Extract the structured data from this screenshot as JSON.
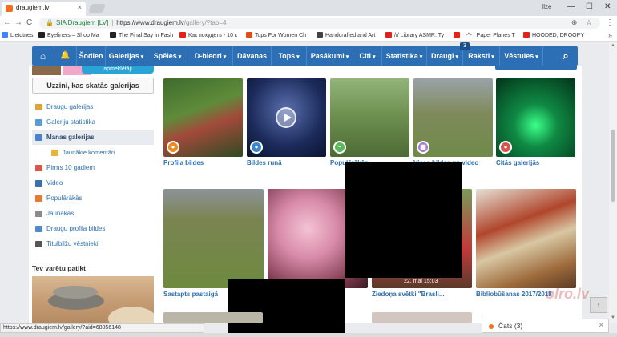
{
  "browser": {
    "tab_title": "draugiem.lv",
    "tab_close": "×",
    "user_label": "Ilze",
    "win_min": "—",
    "win_max": "☐",
    "win_close": "✕",
    "back": "←",
    "forward": "→",
    "reload": "C",
    "site_owner": "SIA Draugiem [LV]",
    "url_separator": "|",
    "url_host": "https://www.draugiem.lv",
    "url_path": "/gallery/?tab=4",
    "url_actions": "⊕ ☆",
    "menu": "⋮",
    "status_url": "https://www.draugiem.lv/gallery/?aid=68056148"
  },
  "bookmarks": [
    {
      "label": "Lietotnes",
      "color": "#4285f4"
    },
    {
      "label": "Eyeliners – Shop Ma",
      "color": "#222222"
    },
    {
      "label": "The Final Say in Fash",
      "color": "#222222"
    },
    {
      "label": "Как похудеть - 10 к",
      "color": "#e62117"
    },
    {
      "label": "Tops For Women Ch",
      "color": "#e64a19"
    },
    {
      "label": "Handcrafted and Art",
      "color": "#444444"
    },
    {
      "label": "/// Library ASMR: Ty",
      "color": "#e62117"
    },
    {
      "label": "_-^-_ Paper Planes T",
      "color": "#e62117"
    },
    {
      "label": "HOODED, DROOPY",
      "color": "#e62117"
    }
  ],
  "bookmarks_more": "»",
  "nav": {
    "home_icon": "⌂",
    "bell_icon": "🔔",
    "search_icon": "⌕",
    "caret": "▾",
    "friends_badge": "3",
    "items": [
      {
        "label": "Šodien",
        "has_caret": false
      },
      {
        "label": "Galerijas",
        "has_caret": true
      },
      {
        "label": "Spēles",
        "has_caret": true
      },
      {
        "label": "D-biedri",
        "has_caret": true
      },
      {
        "label": "Dāvanas",
        "has_caret": false
      },
      {
        "label": "Tops",
        "has_caret": true
      },
      {
        "label": "Pasākumi",
        "has_caret": true
      },
      {
        "label": "Citi",
        "has_caret": true
      },
      {
        "label": "Statistika",
        "has_caret": true
      },
      {
        "label": "Draugi",
        "has_caret": true
      },
      {
        "label": "Raksti",
        "has_caret": true
      },
      {
        "label": "Vēstules",
        "has_caret": true
      }
    ]
  },
  "top_banner": "apmeklētāji",
  "sidebar": {
    "watch_button": "Uzzini, kas skatās galerijas",
    "items": [
      {
        "label": "Draugu galerijas",
        "color": "#d9a441",
        "active": false,
        "sub": false
      },
      {
        "label": "Galeriju statistika",
        "color": "#5b9bd5",
        "active": false,
        "sub": false
      },
      {
        "label": "Manas galerijas",
        "color": "#4b83c4",
        "active": true,
        "sub": false
      },
      {
        "label": "Jaunākie komentāri",
        "color": "#e8b339",
        "active": false,
        "sub": true
      },
      {
        "label": "Pirms 10 gadiem",
        "color": "#d8564c",
        "active": false,
        "sub": false
      },
      {
        "label": "Video",
        "color": "#3a6fb0",
        "active": false,
        "sub": false
      },
      {
        "label": "Populārākās",
        "color": "#e07b39",
        "active": false,
        "sub": false
      },
      {
        "label": "Jaunākās",
        "color": "#8a8a8a",
        "active": false,
        "sub": false
      },
      {
        "label": "Draugu profila bildes",
        "color": "#4f8bc9",
        "active": false,
        "sub": false
      },
      {
        "label": "Titulbilžu vēstnieki",
        "color": "#555555",
        "active": false,
        "sub": false
      }
    ],
    "you_may_like": "Tev varētu patikt"
  },
  "gallery_row1": [
    {
      "label": "Profila bildes",
      "icon_color": "#e98a1f",
      "icon": "●"
    },
    {
      "label": "Bildes runā",
      "icon_color": "#3a86d0",
      "icon": "●"
    },
    {
      "label": "Populārākās",
      "icon_color": "#5cb85c",
      "icon": "~"
    },
    {
      "label": "Visas bildes un video",
      "icon_color": "#a77bd0",
      "icon": "▦"
    },
    {
      "label": "Citās galerijās",
      "icon_color": "#d9534f",
      "icon": "●"
    }
  ],
  "gallery_row2": [
    {
      "label": "Sastapts pastaigā",
      "date": ""
    },
    {
      "label": "",
      "date": ""
    },
    {
      "label": "Ziedoņa svētki \"Brasli...",
      "date": "22. mai 15:03"
    },
    {
      "label": "Bibliobūšanas 2017/2018",
      "date": ""
    }
  ],
  "chat": {
    "label": "Čats (3)",
    "close": "✕"
  },
  "scroll_top": "↑",
  "scroll_up": "▲",
  "scroll_down": "▼",
  "watermark": "olro.lv"
}
